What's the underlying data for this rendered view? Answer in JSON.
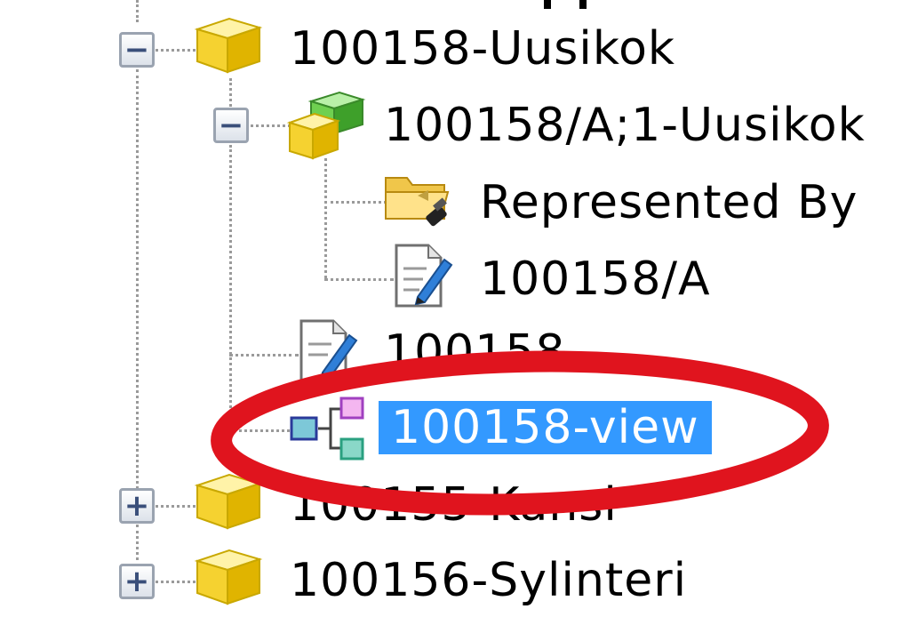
{
  "tree": {
    "items": [
      {
        "label": "100158-Uusikok",
        "icon": "yellow-cube-icon",
        "expanded": true
      },
      {
        "label": "100158/A;1-Uusikok",
        "icon": "revision-cubes-icon",
        "expanded": true
      },
      {
        "label": "Represented By",
        "icon": "folder-link-icon"
      },
      {
        "label": "100158/A",
        "icon": "document-pencil-icon"
      },
      {
        "label": "100158",
        "icon": "document-pencil-icon"
      },
      {
        "label": "100158-view",
        "icon": "structure-view-icon",
        "selected": true
      },
      {
        "label": "100155-Kansi",
        "icon": "yellow-cube-icon",
        "expanded": false
      },
      {
        "label": "100156-Sylinteri",
        "icon": "yellow-cube-icon",
        "expanded": false
      }
    ],
    "expand_symbol": "+",
    "collapse_symbol": "−"
  },
  "colors": {
    "selection": "#3399ff",
    "annotation": "#e0141e",
    "cube_yellow": "#f5d230",
    "cube_green": "#4caf3a"
  }
}
